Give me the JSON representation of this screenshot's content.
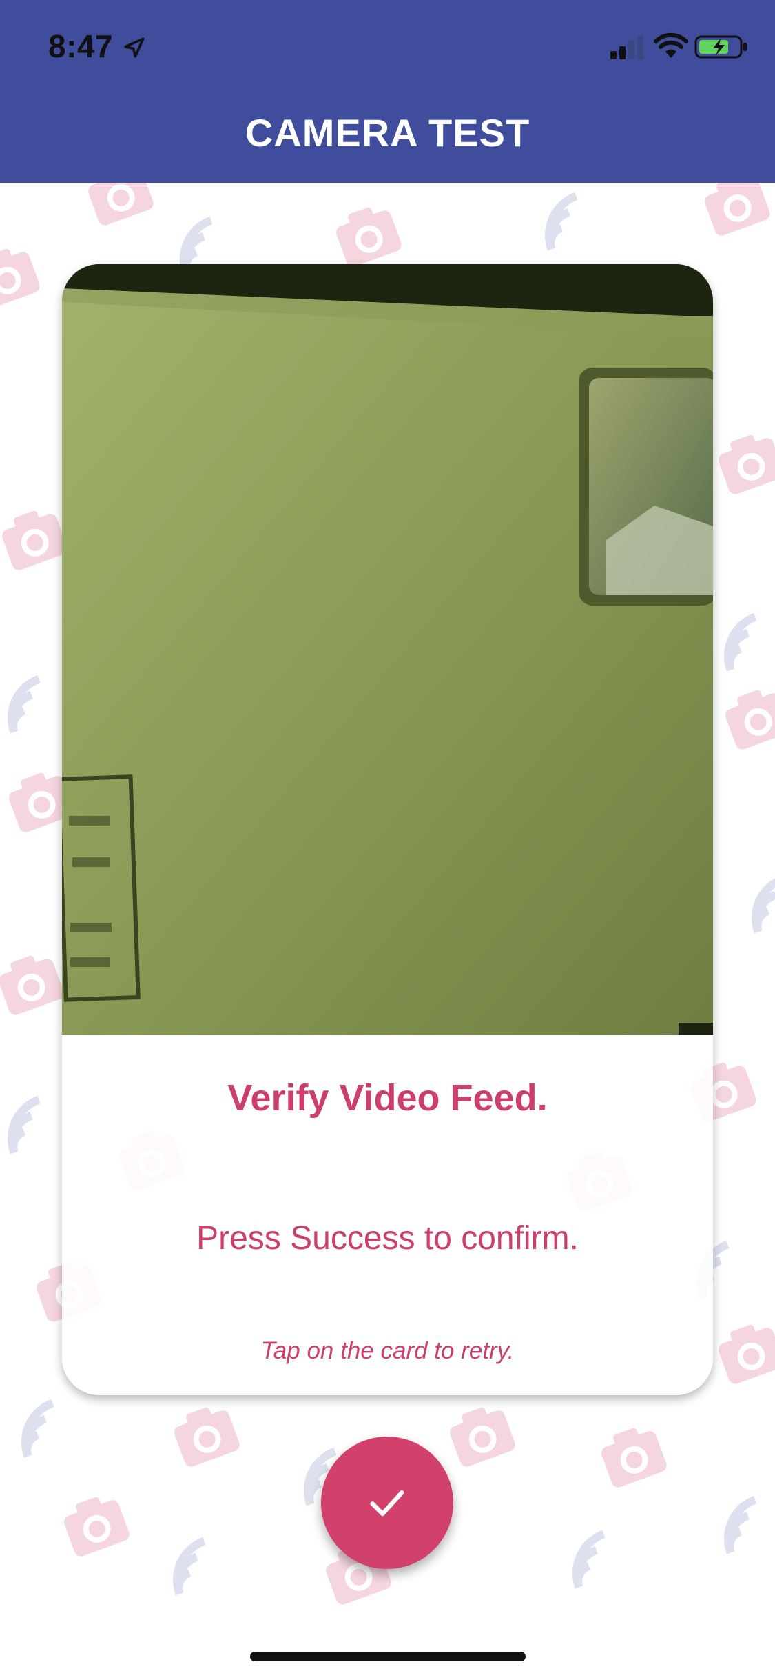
{
  "status_bar": {
    "time": "8:47",
    "icons": [
      "location-arrow-icon",
      "cellular-signal-icon",
      "wifi-icon",
      "battery-charging-icon"
    ]
  },
  "header": {
    "title": "CAMERA TEST"
  },
  "card": {
    "title": "Verify Video Feed.",
    "subtitle": "Press Success to confirm.",
    "hint": "Tap on the card to retry."
  },
  "success_button": {
    "icon": "check-icon"
  },
  "colors": {
    "header_bg": "#3f4d9c",
    "accent": "#d1416c",
    "text_accent": "#cc3f6c",
    "pattern_camera": "#f6d6de",
    "pattern_wifi": "#dde0ef"
  }
}
